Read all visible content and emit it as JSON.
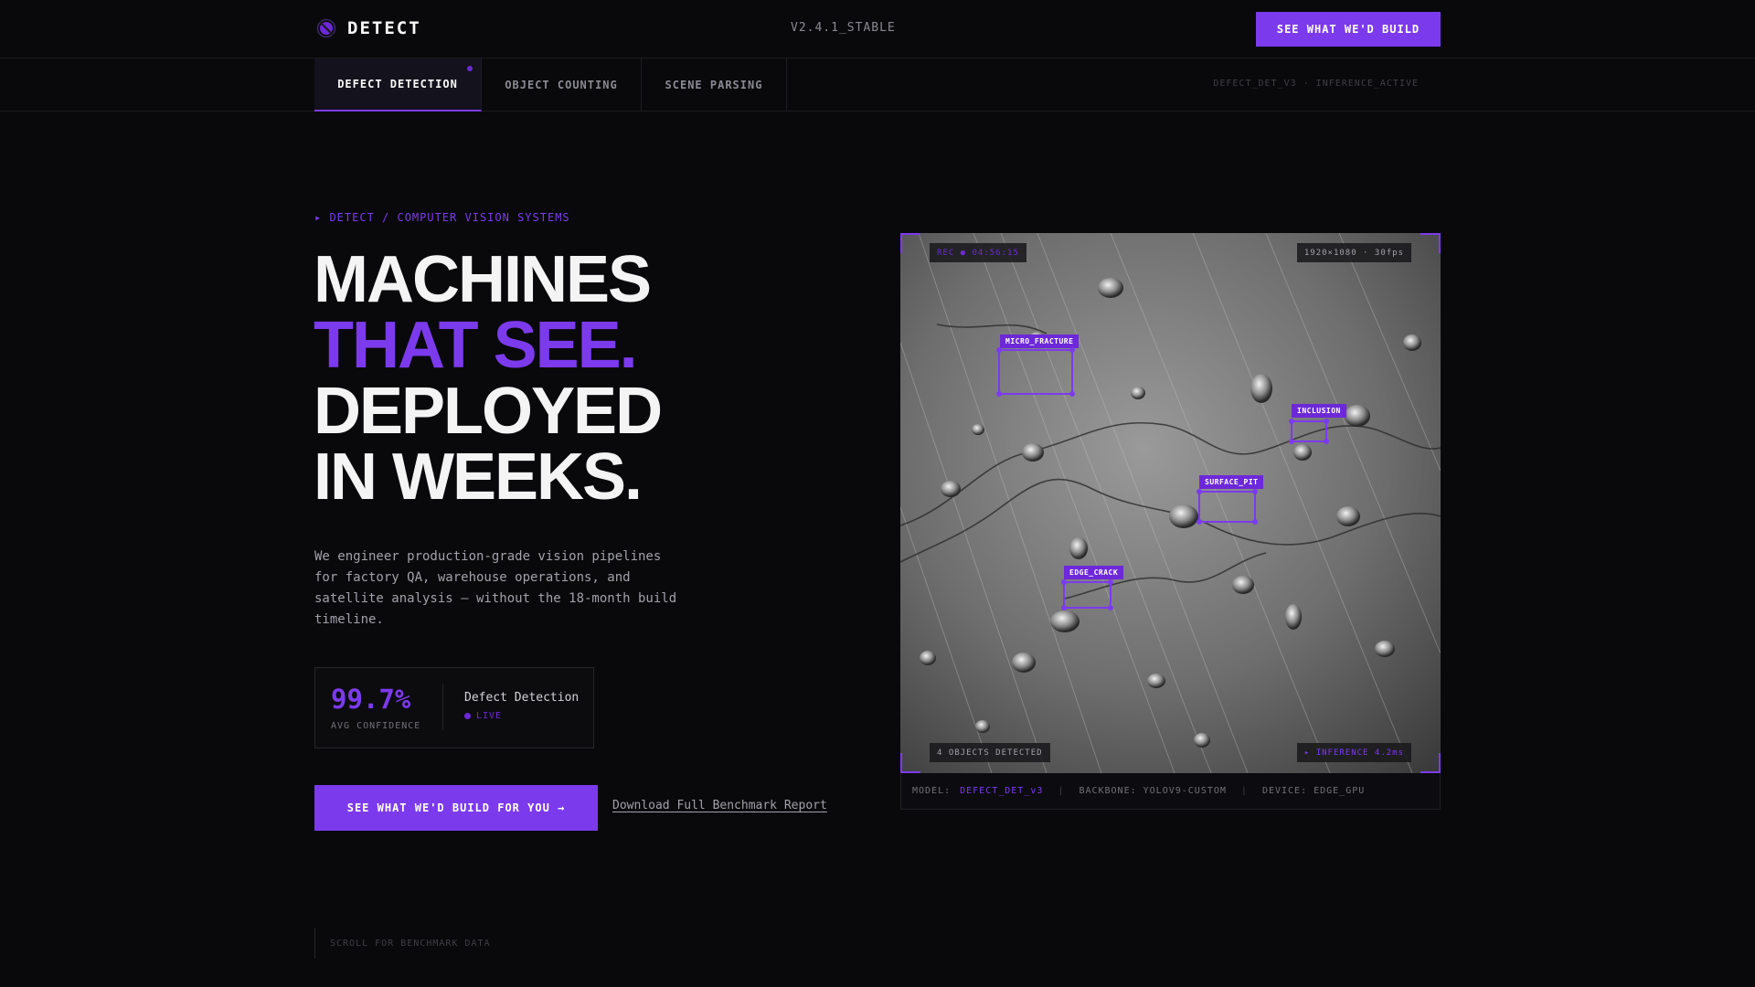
{
  "header": {
    "logo_text": "DETECT",
    "version": "V2.4.1_STABLE",
    "cta_label": "SEE WHAT WE'D BUILD"
  },
  "tabs": [
    {
      "label": "DEFECT DETECTION",
      "active": true
    },
    {
      "label": "OBJECT COUNTING",
      "active": false
    },
    {
      "label": "SCENE PARSING",
      "active": false
    }
  ],
  "tab_status": "DEFECT_DET_V3 · INFERENCE_ACTIVE",
  "hero": {
    "eyebrow": "▸ DETECT / COMPUTER VISION SYSTEMS",
    "headline": [
      "MACHINES",
      "THAT SEE.",
      "DEPLOYED",
      "IN WEEKS."
    ],
    "description": "We engineer production-grade vision pipelines for factory QA, warehouse operations, and satellite analysis — without the 18-month build timeline.",
    "stat": {
      "value": "99.7%",
      "label": "AVG CONFIDENCE",
      "title": "Defect Detection",
      "status": "LIVE"
    },
    "cta_label": "SEE WHAT WE'D BUILD FOR YOU →",
    "secondary_link": "Download Full Benchmark Report",
    "scroll_hint": "SCROLL FOR BENCHMARK DATA"
  },
  "viewer": {
    "rec": "REC ● 04:56:15",
    "resolution": "1920×1080 · 30fps",
    "objects": "4 OBJECTS DETECTED",
    "inference": "▸ INFERENCE 4.2ms",
    "detections": [
      "MICRO_FRACTURE",
      "INCLUSION",
      "SURFACE_PIT",
      "EDGE_CRACK"
    ],
    "meta": {
      "model_label": "MODEL:",
      "model_value": "DEFECT_DET_v3",
      "backbone": "BACKBONE: YOLOV9-CUSTOM",
      "device": "DEVICE: EDGE_GPU"
    }
  },
  "colors": {
    "accent": "#7c3aed",
    "background": "#09090b"
  }
}
